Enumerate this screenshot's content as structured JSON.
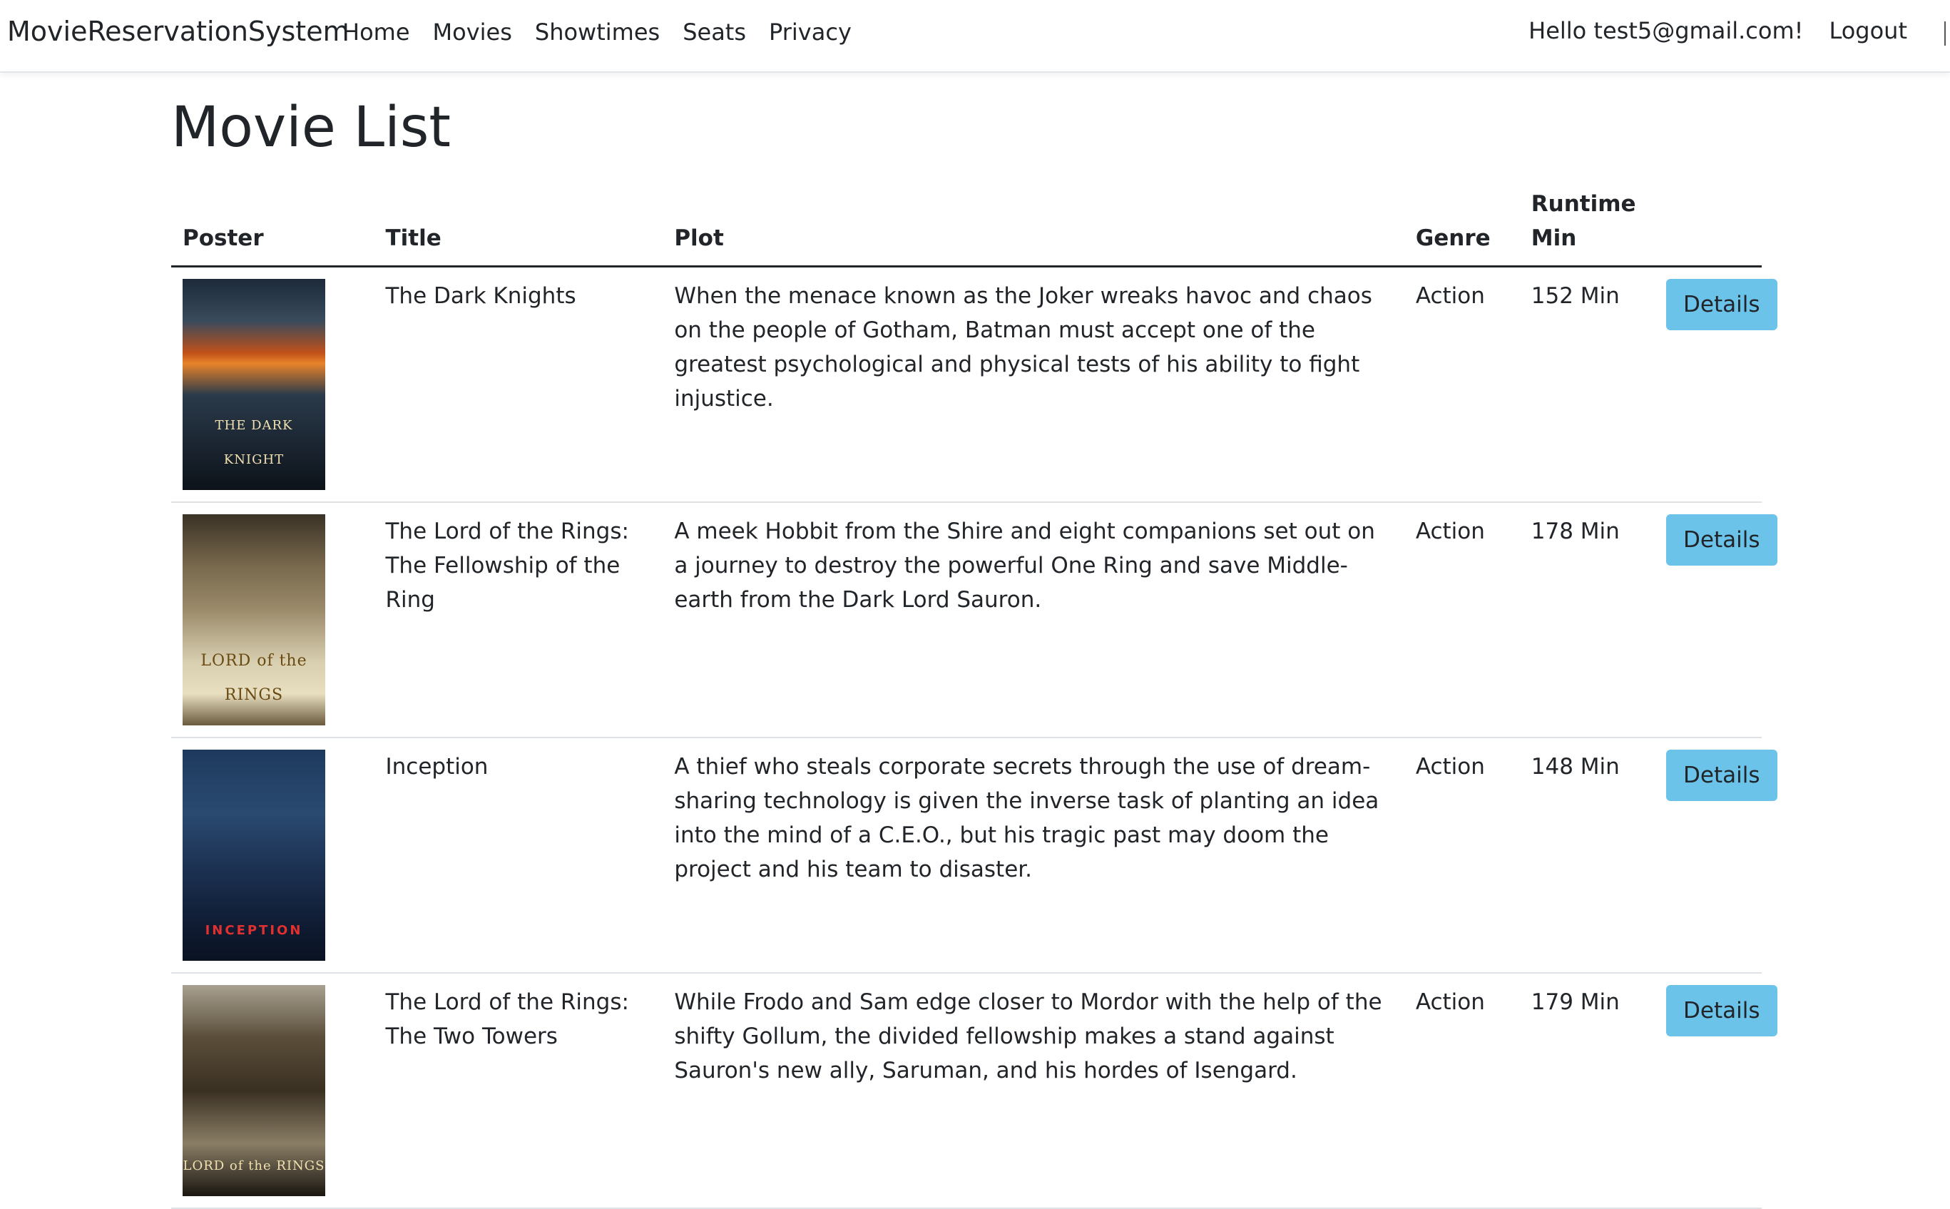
{
  "navbar": {
    "brand": "MovieReservationSystem",
    "links": [
      "Home",
      "Movies",
      "Showtimes",
      "Seats",
      "Privacy"
    ],
    "greeting": "Hello test5@gmail.com!",
    "logout": "Logout"
  },
  "page": {
    "title": "Movie List"
  },
  "table": {
    "headers": {
      "poster": "Poster",
      "title": "Title",
      "plot": "Plot",
      "genre": "Genre",
      "runtime_line1": "Runtime",
      "runtime_line2": "Min"
    },
    "rows": [
      {
        "poster_caption": "THE DARK KNIGHT",
        "title": "The Dark Knights",
        "plot": "When the menace known as the Joker wreaks havoc and chaos on the people of Gotham, Batman must accept one of the greatest psychological and physical tests of his ability to fight injustice.",
        "genre": "Action",
        "runtime": "152 Min",
        "action": "Details"
      },
      {
        "poster_caption": "LORD of the RINGS",
        "title": "The Lord of the Rings: The Fellowship of the Ring",
        "plot": "A meek Hobbit from the Shire and eight companions set out on a journey to destroy the powerful One Ring and save Middle-earth from the Dark Lord Sauron.",
        "genre": "Action",
        "runtime": "178 Min",
        "action": "Details"
      },
      {
        "poster_caption": "INCEPTION",
        "title": "Inception",
        "plot": "A thief who steals corporate secrets through the use of dream-sharing technology is given the inverse task of planting an idea into the mind of a C.E.O., but his tragic past may doom the project and his team to disaster.",
        "genre": "Action",
        "runtime": "148 Min",
        "action": "Details"
      },
      {
        "poster_caption": "LORD of the RINGS",
        "title": "The Lord of the Rings: The Two Towers",
        "plot": "While Frodo and Sam edge closer to Mordor with the help of the shifty Gollum, the divided fellowship makes a stand against Sauron's new ally, Saruman, and his hordes of Isengard.",
        "genre": "Action",
        "runtime": "179 Min",
        "action": "Details"
      }
    ]
  },
  "colors": {
    "button": "#6cc3ea",
    "text": "#212529",
    "divider": "#dee2e6"
  }
}
